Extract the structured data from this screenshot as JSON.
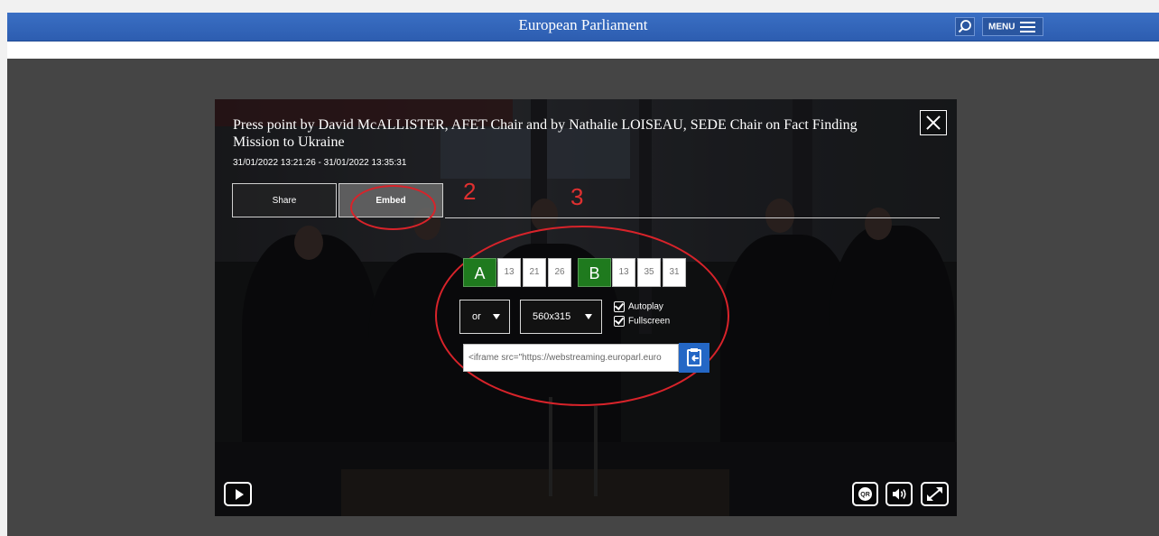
{
  "site": {
    "title": "European Parliament",
    "menu_label": "MENU"
  },
  "player": {
    "title": "Press point by David McALLISTER, AFET Chair and by Nathalie LOISEAU, SEDE Chair on Fact Finding Mission to Ukraine",
    "time_range": "31/01/2022 13:21:26 - 31/01/2022 13:35:31",
    "tabs": [
      {
        "label": "Share",
        "active": false
      },
      {
        "label": "Embed",
        "active": true
      }
    ],
    "annotations": {
      "two": "2",
      "three": "3"
    },
    "timecode_a": {
      "letter": "A",
      "h": "13",
      "m": "21",
      "s": "26"
    },
    "timecode_b": {
      "letter": "B",
      "h": "13",
      "m": "35",
      "s": "31"
    },
    "language_select": "or",
    "size_select": "560x315",
    "checkboxes": [
      {
        "label": "Autoplay",
        "checked": true
      },
      {
        "label": "Fullscreen",
        "checked": true
      }
    ],
    "embed_code": "<iframe src=\"https://webstreaming.europarl.euro",
    "colors": {
      "header_blue": "#2d5db0",
      "timecode_green": "#1f7a1e",
      "copy_button_blue": "#2467c5",
      "annotation_red": "#d8232a"
    },
    "icons": [
      "search-icon",
      "menu-icon",
      "close-icon",
      "copy-clipboard-icon",
      "play-icon",
      "qr-code-icon",
      "volume-icon",
      "fullscreen-icon"
    ]
  }
}
